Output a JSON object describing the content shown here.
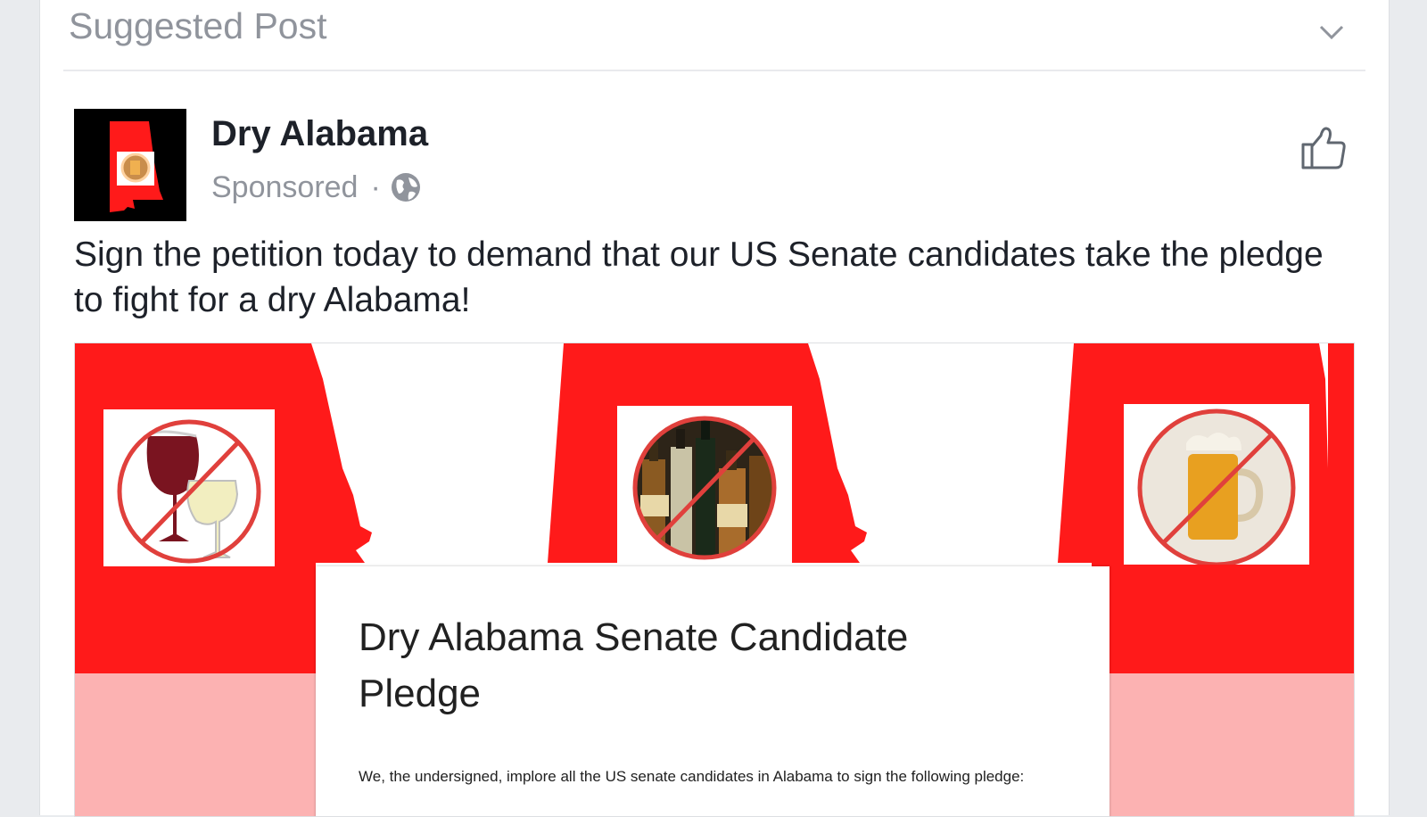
{
  "card": {
    "header": "Suggested Post",
    "header_icon": "chevron-down-icon"
  },
  "post": {
    "page_name": "Dry Alabama",
    "sponsored_label": "Sponsored",
    "separator": "·",
    "audience_icon": "globe-icon",
    "like_icon": "thumbs-up-icon",
    "text": "Sign the petition today to demand that our US Senate candidates take the pledge to fight for a dry Alabama!"
  },
  "ad_image": {
    "icons": [
      "no-wine-icon",
      "no-liquor-icon",
      "no-beer-icon"
    ],
    "pledge_title": "Dry Alabama Senate Candidate Pledge",
    "pledge_body": "We, the undersigned, implore all the US senate candidates in Alabama to sign the following pledge:"
  },
  "colors": {
    "brand_red": "#ff1a1a",
    "pale_red": "#fcb2b2",
    "text_dark": "#1d2129",
    "text_muted": "#90949c"
  }
}
